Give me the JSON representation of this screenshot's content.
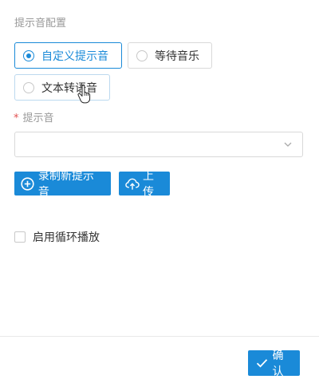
{
  "section_title": "提示音配置",
  "radio_options": [
    {
      "label": "自定义提示音",
      "checked": true
    },
    {
      "label": "等待音乐",
      "checked": false
    },
    {
      "label": "文本转语音",
      "checked": false
    }
  ],
  "tone_field": {
    "required_mark": "*",
    "label": "提示音",
    "selected_value": ""
  },
  "buttons": {
    "record": {
      "label": "录制新提示音",
      "icon": "plus-circle-icon"
    },
    "upload": {
      "label": "上传",
      "icon": "cloud-upload-icon"
    },
    "confirm": {
      "label": "确认",
      "icon": "check-icon"
    }
  },
  "loop_checkbox": {
    "label": "启用循环播放",
    "checked": false
  },
  "colors": {
    "accent": "#1a8ad8",
    "required": "#e25151",
    "border": "#d9d9d9"
  }
}
